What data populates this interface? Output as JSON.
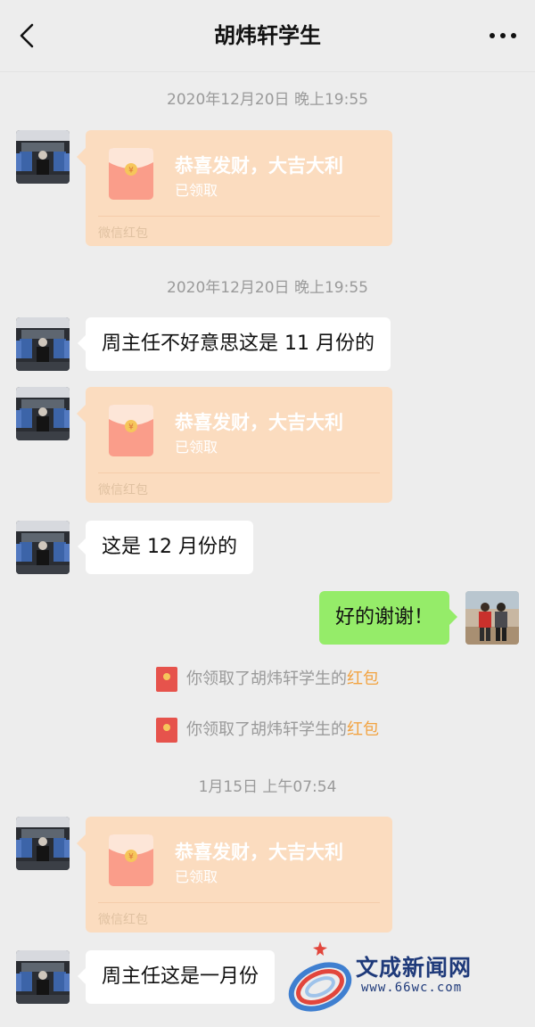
{
  "header": {
    "title": "胡炜轩学生",
    "back_icon": "chevron-left-icon",
    "more_icon": "more-dots-icon"
  },
  "messages": {
    "t1": "2020年12月20日 晚上19:55",
    "rp1": {
      "title": "恭喜发财，大吉大利",
      "status": "已领取",
      "footer": "微信红包"
    },
    "t2": "2020年12月20日 晚上19:55",
    "m1": "周主任不好意思这是 11 月份的",
    "rp2": {
      "title": "恭喜发财，大吉大利",
      "status": "已领取",
      "footer": "微信红包"
    },
    "m2": "这是 12 月份的",
    "m3": "好的谢谢！",
    "sys1": {
      "prefix": "你领取了胡炜轩学生的",
      "link": "红包"
    },
    "sys2": {
      "prefix": "你领取了胡炜轩学生的",
      "link": "红包"
    },
    "t3": "1月15日 上午07:54",
    "rp3": {
      "title": "恭喜发财，大吉大利",
      "status": "已领取",
      "footer": "微信红包"
    },
    "m4": "周主任这是一月份"
  },
  "watermark": {
    "name": "文成新闻网",
    "url": "www.66wc.com"
  },
  "colors": {
    "background": "#ededed",
    "red_packet": "#fbdcbf",
    "self_bubble": "#95ec69",
    "link": "#f2a341"
  }
}
